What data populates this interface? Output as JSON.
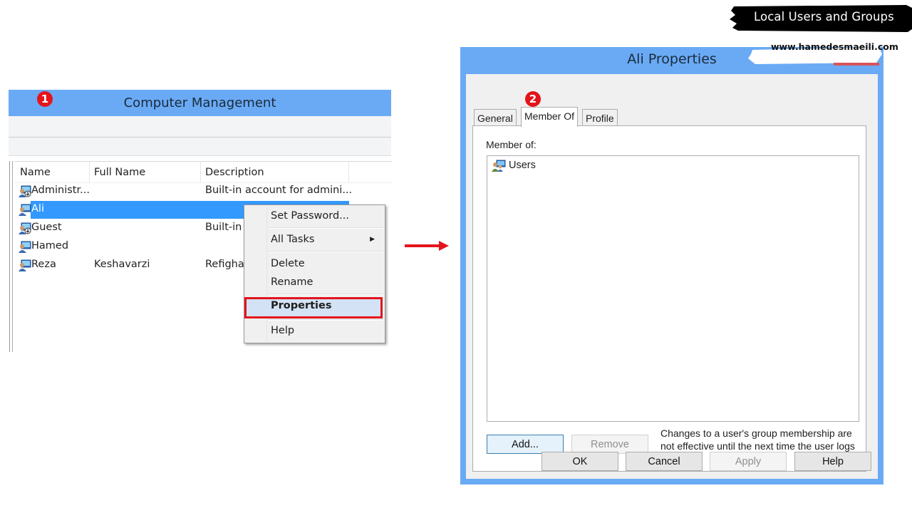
{
  "banner": {
    "title": "Local Users and Groups",
    "website": "www.hamedesmaeili.com"
  },
  "steps": {
    "step1": "1",
    "step2": "2"
  },
  "computer_management": {
    "title": "Computer Management",
    "columns": [
      "Name",
      "Full Name",
      "Description"
    ],
    "rows": [
      {
        "name": "Administr...",
        "full_name": "",
        "description": "Built-in account for admini...",
        "icon": "admin-user-icon",
        "selected": false
      },
      {
        "name": "Ali",
        "full_name": "",
        "description": "",
        "icon": "user-icon",
        "selected": true
      },
      {
        "name": "Guest",
        "full_name": "",
        "description": "Built-in a",
        "icon": "admin-user-icon",
        "selected": false
      },
      {
        "name": "Hamed",
        "full_name": "",
        "description": "",
        "icon": "user-icon",
        "selected": false
      },
      {
        "name": "Reza",
        "full_name": "Keshavarzi",
        "description": "Refighar",
        "icon": "user-icon",
        "selected": false
      }
    ],
    "context_menu": {
      "items": [
        {
          "label": "Set Password..."
        },
        {
          "label": "All Tasks",
          "submenu": true
        },
        {
          "label": "Delete"
        },
        {
          "label": "Rename"
        },
        {
          "label": "Properties",
          "highlighted": true
        },
        {
          "label": "Help"
        }
      ]
    }
  },
  "properties_dialog": {
    "title": "Ali Properties",
    "tabs": [
      {
        "label": "General",
        "active": false
      },
      {
        "label": "Member Of",
        "active": true
      },
      {
        "label": "Profile",
        "active": false
      }
    ],
    "member_of_label": "Member of:",
    "groups": [
      "Users"
    ],
    "add_button": "Add...",
    "remove_button": "Remove",
    "note": "Changes to a user's group membership are not effective until the next time the user logs on.",
    "footer_buttons": {
      "ok": "OK",
      "cancel": "Cancel",
      "apply": "Apply",
      "help": "Help"
    }
  },
  "colors": {
    "title_bar": "#6aaaf5",
    "selection": "#3399ff",
    "highlight_border": "#e3141c",
    "arrow": "#e3141c"
  }
}
